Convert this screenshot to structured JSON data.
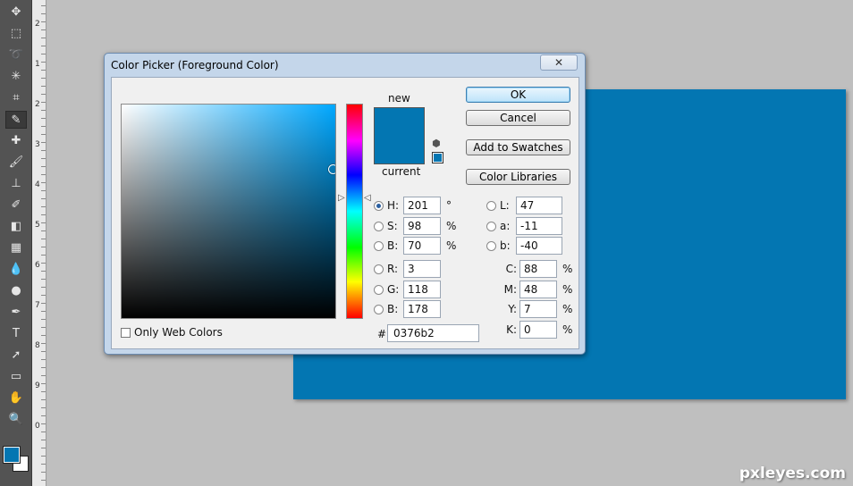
{
  "dialog": {
    "title": "Color Picker (Foreground Color)",
    "close_label": "✕",
    "new_label": "new",
    "current_label": "current",
    "ok_label": "OK",
    "cancel_label": "Cancel",
    "add_swatches_label": "Add to Swatches",
    "libraries_label": "Color Libraries",
    "only_web_colors_label": "Only Web Colors",
    "hsb": {
      "h": {
        "label": "H:",
        "value": "201",
        "unit": "°",
        "selected": true
      },
      "s": {
        "label": "S:",
        "value": "98",
        "unit": "%"
      },
      "b": {
        "label": "B:",
        "value": "70",
        "unit": "%"
      }
    },
    "rgb": {
      "r": {
        "label": "R:",
        "value": "3"
      },
      "g": {
        "label": "G:",
        "value": "118"
      },
      "b": {
        "label": "B:",
        "value": "178"
      }
    },
    "lab": {
      "l": {
        "label": "L:",
        "value": "47"
      },
      "a": {
        "label": "a:",
        "value": "-11"
      },
      "b": {
        "label": "b:",
        "value": "-40"
      }
    },
    "cmyk": {
      "c": {
        "label": "C:",
        "value": "88",
        "unit": "%"
      },
      "m": {
        "label": "M:",
        "value": "48",
        "unit": "%"
      },
      "y": {
        "label": "Y:",
        "value": "7",
        "unit": "%"
      },
      "k": {
        "label": "K:",
        "value": "0",
        "unit": "%"
      }
    },
    "hex_label": "#",
    "hex_value": "0376b2",
    "field_hue_color": "#00a8ff",
    "picker_saturation": 0.98,
    "picker_brightness": 0.7,
    "hue_slider_level": 0.44
  },
  "colors": {
    "selected": "#0376b2",
    "canvas_fill": "#0376b2"
  },
  "toolbar": {
    "icons": [
      "move-icon",
      "marquee-icon",
      "lasso-icon",
      "magic-wand-icon",
      "crop-icon",
      "eyedropper-icon",
      "healing-brush-icon",
      "brush-icon",
      "clone-stamp-icon",
      "history-brush-icon",
      "eraser-icon",
      "gradient-icon",
      "blur-icon",
      "dodge-icon",
      "pen-icon",
      "type-icon",
      "path-selection-icon",
      "rectangle-icon",
      "hand-icon",
      "zoom-icon"
    ],
    "glyphs": [
      "✥",
      "⬚",
      "➰",
      "✳",
      "⌗",
      "✎",
      "✚",
      "🖌",
      "⊥",
      "✐",
      "◧",
      "▦",
      "💧",
      "●",
      "✒",
      "T",
      "➚",
      "▭",
      "✋",
      "🔍"
    ]
  },
  "ruler": {
    "numbers": [
      "2",
      "1",
      "2",
      "3",
      "4",
      "5",
      "6",
      "7",
      "8",
      "9",
      "0"
    ]
  },
  "watermark": "pxleyes.com"
}
